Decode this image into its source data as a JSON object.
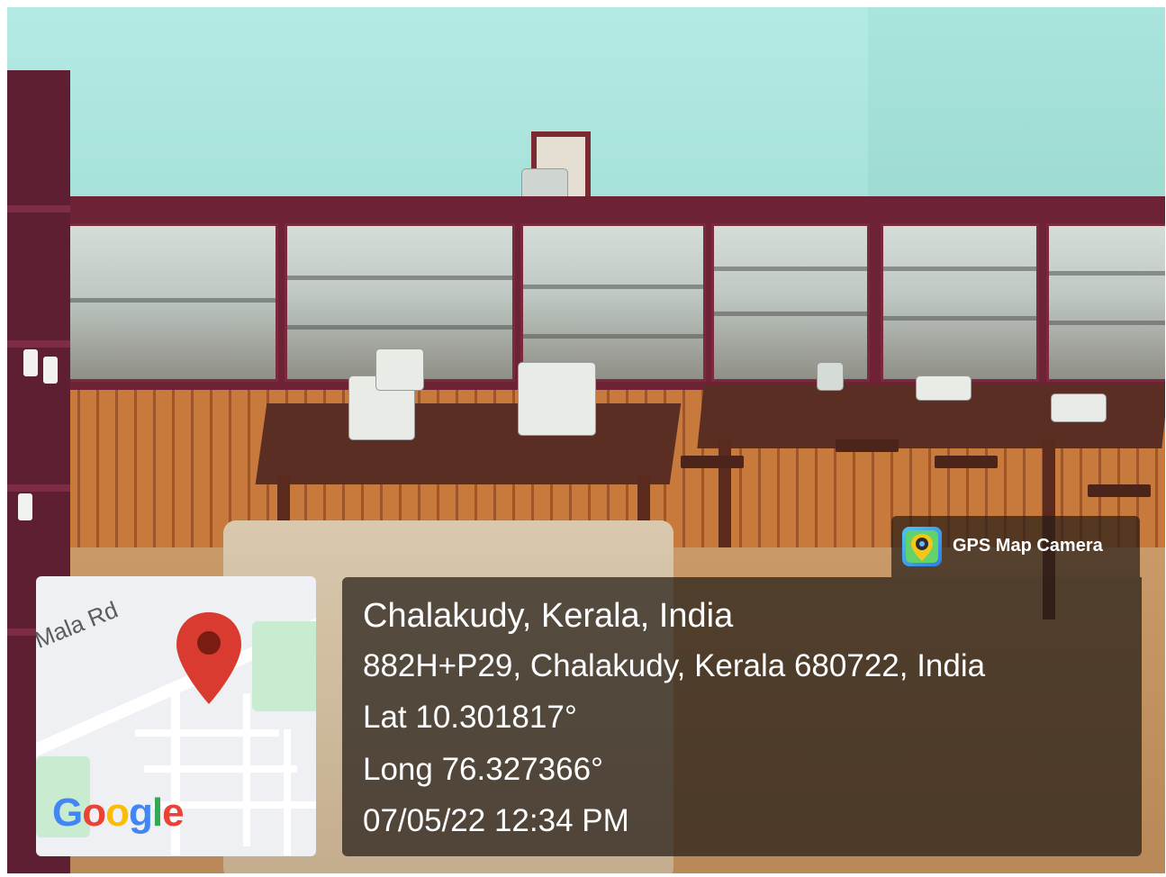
{
  "map": {
    "road_label": "Mala Rd",
    "logo_text": "Google"
  },
  "badge": {
    "icon": "gps-map-camera-app-icon",
    "label": "GPS Map Camera"
  },
  "location": {
    "title": "Chalakudy, Kerala, India",
    "address": "882H+P29, Chalakudy, Kerala 680722, India",
    "latitude": "Lat 10.301817°",
    "longitude": "Long 76.327366°",
    "datetime": "07/05/22 12:34 PM"
  },
  "colors": {
    "overlay": "#231c16",
    "map_pin": "#d93b30",
    "cabinet_frame": "#6d2235"
  }
}
